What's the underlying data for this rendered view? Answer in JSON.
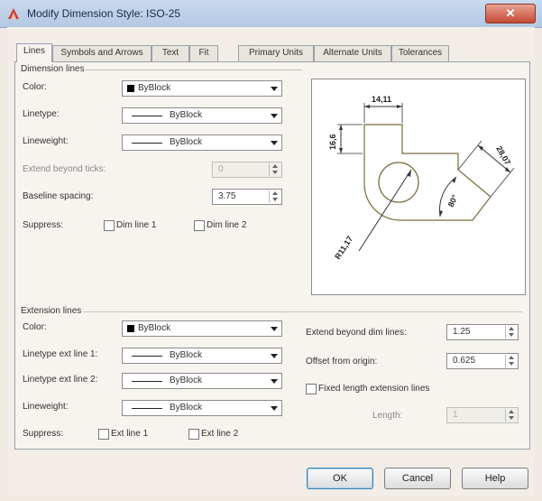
{
  "window": {
    "title": "Modify Dimension Style: ISO-25",
    "close_glyph": "✕"
  },
  "tabs": [
    {
      "label": "Lines",
      "active": true
    },
    {
      "label": "Symbols and Arrows"
    },
    {
      "label": "Text"
    },
    {
      "label": "Fit"
    },
    {
      "label": "Primary Units"
    },
    {
      "label": "Alternate Units"
    },
    {
      "label": "Tolerances"
    }
  ],
  "dimension_lines": {
    "group_label": "Dimension lines",
    "color_label": "Color:",
    "color_value": "ByBlock",
    "linetype_label": "Linetype:",
    "linetype_value": "ByBlock",
    "lineweight_label": "Lineweight:",
    "lineweight_value": "ByBlock",
    "extend_label": "Extend beyond ticks:",
    "extend_value": "0",
    "baseline_label": "Baseline spacing:",
    "baseline_value": "3.75",
    "suppress_label": "Suppress:",
    "dim_line_1": "Dim line 1",
    "dim_line_2": "Dim line 2"
  },
  "extension_lines": {
    "group_label": "Extension lines",
    "color_label": "Color:",
    "color_value": "ByBlock",
    "ext1_label": "Linetype ext line 1:",
    "ext1_value": "ByBlock",
    "ext2_label": "Linetype ext line 2:",
    "ext2_value": "ByBlock",
    "lineweight_label": "Lineweight:",
    "lineweight_value": "ByBlock",
    "suppress_label": "Suppress:",
    "ext_line_1": "Ext line 1",
    "ext_line_2": "Ext line 2",
    "extend_dim_label": "Extend beyond dim lines:",
    "extend_dim_value": "1.25",
    "offset_label": "Offset from origin:",
    "offset_value": "0.625",
    "fixed_length_label": "Fixed length extension lines",
    "length_label": "Length:",
    "length_value": "1"
  },
  "preview": {
    "dim_top": "14,11",
    "dim_left": "16,6",
    "dim_right": "28,07",
    "dim_angle": "80°",
    "dim_radius": "R11,17"
  },
  "buttons": {
    "ok": "OK",
    "cancel": "Cancel",
    "help": "Help"
  },
  "colors": {
    "accent": "#3c7fb1",
    "close": "#c64a35",
    "drawing": "#7a6a3a"
  }
}
